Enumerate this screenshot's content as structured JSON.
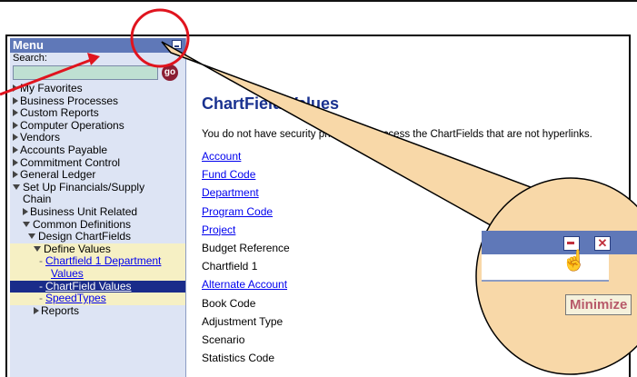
{
  "sidebar": {
    "title": "Menu",
    "search_label": "Search:",
    "go_label": "go",
    "items": [
      {
        "label": "My Favorites"
      },
      {
        "label": "Business Processes"
      },
      {
        "label": "Custom Reports"
      },
      {
        "label": "Computer Operations"
      },
      {
        "label": "Vendors"
      },
      {
        "label": "Accounts Payable"
      },
      {
        "label": "Commitment Control"
      },
      {
        "label": "General Ledger"
      },
      {
        "label": "Set Up Financials/Supply"
      },
      {
        "label": "Chain"
      },
      {
        "label": "Business Unit Related"
      },
      {
        "label": "Common Definitions"
      },
      {
        "label": "Design ChartFields"
      },
      {
        "label": "Define Values"
      },
      {
        "label": "Chartfield 1 Department"
      },
      {
        "label": "Values"
      },
      {
        "label": "ChartField Values"
      },
      {
        "label": "SpeedTypes"
      },
      {
        "label": "Reports"
      }
    ]
  },
  "main": {
    "title": "ChartField Values",
    "notice": "You do not have security privileges to access the ChartFields that are not hyperlinks.",
    "chartfields": [
      {
        "label": "Account"
      },
      {
        "label": "Fund Code"
      },
      {
        "label": "Department"
      },
      {
        "label": "Program Code"
      },
      {
        "label": "Project"
      },
      {
        "label": "Budget Reference"
      },
      {
        "label": "Chartfield 1"
      },
      {
        "label": "Alternate Account"
      },
      {
        "label": "Book Code"
      },
      {
        "label": "Adjustment Type"
      },
      {
        "label": "Scenario"
      },
      {
        "label": "Statistics Code"
      }
    ]
  },
  "callout": {
    "tooltip": "Minimize"
  },
  "colors": {
    "menu_header": "#5f78b8",
    "selected": "#1a2c8a",
    "highlight": "#f6f0c4",
    "title": "#1a3290",
    "annotation": "#e0141e",
    "callout_fill": "#f8d8a8"
  }
}
